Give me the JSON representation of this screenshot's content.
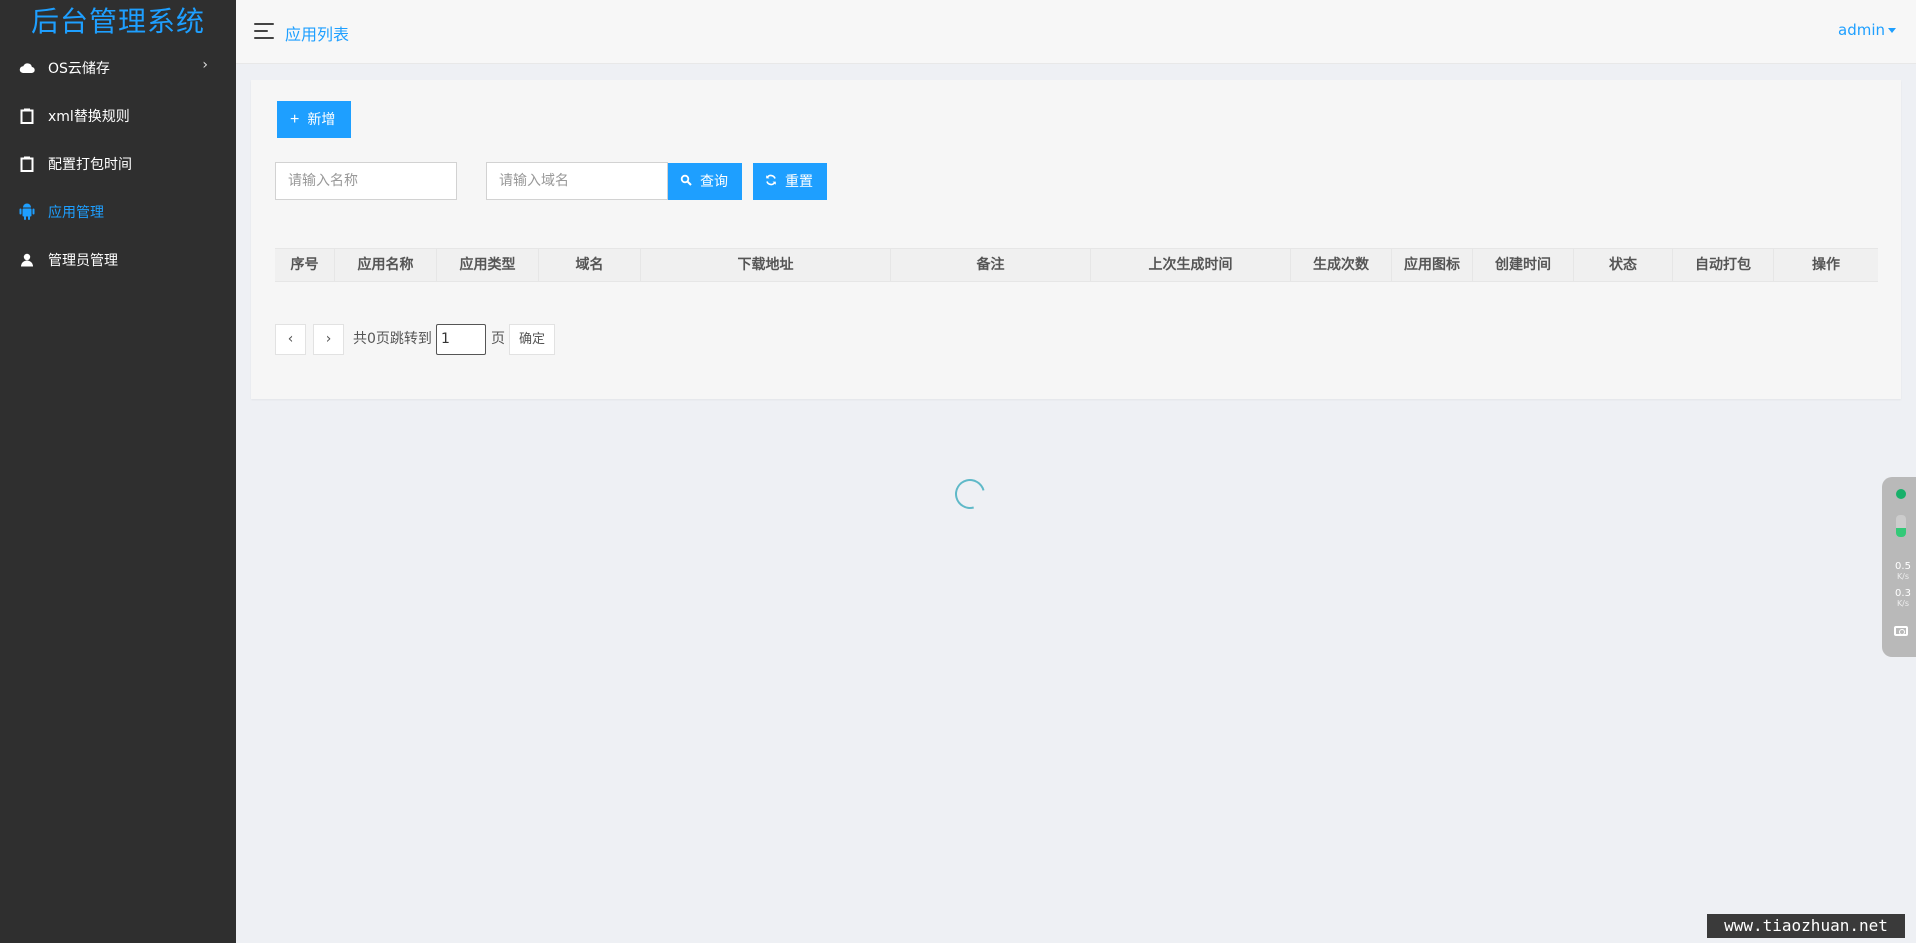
{
  "app": {
    "title": "后台管理系统"
  },
  "sidebar": {
    "items": [
      {
        "label": "OS云储存",
        "icon": "cloud-icon",
        "active": false,
        "has_children": true
      },
      {
        "label": "xml替换规则",
        "icon": "clipboard-icon",
        "active": false
      },
      {
        "label": "配置打包时间",
        "icon": "clipboard-icon",
        "active": false
      },
      {
        "label": "应用管理",
        "icon": "android-icon",
        "active": true
      },
      {
        "label": "管理员管理",
        "icon": "user-icon",
        "active": false
      }
    ],
    "chevron": "›"
  },
  "header": {
    "title": "应用列表",
    "user": "admin"
  },
  "toolbar": {
    "add_label": "新增",
    "add_icon": "+",
    "search_label": "查询",
    "reset_label": "重置"
  },
  "search": {
    "name_placeholder": "请输入名称",
    "domain_placeholder": "请输入域名"
  },
  "table": {
    "columns": [
      "序号",
      "应用名称",
      "应用类型",
      "域名",
      "下载地址",
      "备注",
      "上次生成时间",
      "生成次数",
      "应用图标",
      "创建时间",
      "状态",
      "自动打包",
      "操作"
    ],
    "rows": []
  },
  "pagination": {
    "prev": "‹",
    "next": "›",
    "total_text": "共0页跳转到",
    "current_page": "1",
    "page_unit": "页",
    "confirm_label": "确定"
  },
  "network_widget": {
    "upload_rate": "0.5",
    "upload_unit": "K/s",
    "download_rate": "0.3",
    "download_unit": "K/s"
  },
  "watermark": {
    "text": "www.tiaozhuan.net"
  },
  "colors": {
    "accent": "#1e9fff",
    "sidebar_bg": "#2f2f2f",
    "status_green": "#18b06a"
  }
}
